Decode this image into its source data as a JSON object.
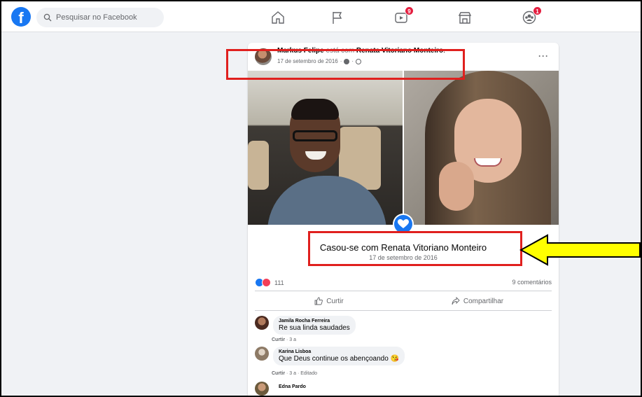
{
  "topbar": {
    "logo": "f",
    "search_placeholder": "Pesquisar no Facebook",
    "nav": [
      {
        "name": "home",
        "badge": ""
      },
      {
        "name": "pages-flag",
        "badge": ""
      },
      {
        "name": "watch",
        "badge": "9"
      },
      {
        "name": "marketplace",
        "badge": ""
      },
      {
        "name": "groups",
        "badge": "1"
      }
    ]
  },
  "post": {
    "author": "Markus Felipe",
    "connector": " está com ",
    "tagged": "Renata Vitoriano Monteiro",
    "tagged_suffix": ".",
    "date": "17 de setembro de 2016",
    "meta_sep": "·",
    "more": "···",
    "event_title": "Casou-se com Renata Vitoriano Monteiro",
    "event_date": "17 de setembro de 2016",
    "reaction_count": "111",
    "comments_count": "9 comentários",
    "actions": {
      "like": "Curtir",
      "share": "Compartilhar"
    }
  },
  "comments": [
    {
      "name": "Jamila Rocha Ferreira",
      "text": "Re sua linda saudades",
      "actions": "Curtir",
      "time": " · 3 a"
    },
    {
      "name": "Karina Lisboa",
      "text": "Que Deus continue os abençoando",
      "emoji": "😘",
      "actions": "Curtir",
      "time": " · 3 a · Editado"
    },
    {
      "name": "Edna Pardo",
      "text": "",
      "actions": "",
      "time": ""
    }
  ],
  "colors": {
    "facebook_blue": "#1877f2",
    "annotation_red": "#e0201e",
    "annotation_arrow": "#ffff00",
    "badge_red": "#e41e3f"
  }
}
